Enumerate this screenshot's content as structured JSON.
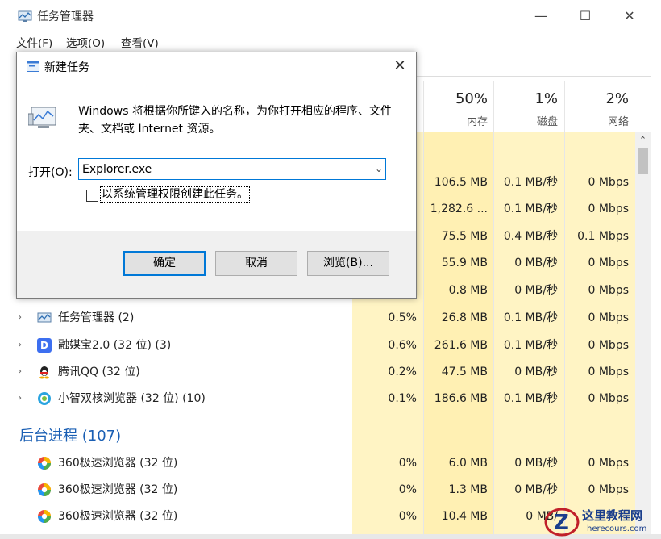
{
  "window": {
    "title": "任务管理器",
    "minimize_icon": "minimize-icon",
    "maximize_icon": "maximize-icon",
    "close_icon": "close-icon"
  },
  "menu": [
    "文件(F)",
    "选项(O)",
    "查看(V)"
  ],
  "columns": {
    "cpu_partial": "",
    "mem": {
      "pct": "50%",
      "label": "内存"
    },
    "disk": {
      "pct": "1%",
      "label": "磁盘"
    },
    "net": {
      "pct": "2%",
      "label": "网络"
    }
  },
  "hidden_rows": [
    {
      "mem": "106.5 MB",
      "disk": "0.1 MB/秒",
      "net": "0 Mbps"
    },
    {
      "mem": "1,282.6 ...",
      "disk": "0.1 MB/秒",
      "net": "0 Mbps"
    },
    {
      "mem": "75.5 MB",
      "disk": "0.4 MB/秒",
      "net": "0.1 Mbps"
    },
    {
      "mem": "55.9 MB",
      "disk": "0 MB/秒",
      "net": "0 Mbps"
    },
    {
      "mem": "0.8 MB",
      "disk": "0 MB/秒",
      "net": "0 Mbps"
    }
  ],
  "app_rows": [
    {
      "name": "任务管理器 (2)",
      "cpu": "0.5%",
      "mem": "26.8 MB",
      "disk": "0.1 MB/秒",
      "net": "0 Mbps",
      "icon": "task-manager-icon",
      "color": "#5a8fc7"
    },
    {
      "name": "融媒宝2.0 (32 位) (3)",
      "cpu": "0.6%",
      "mem": "261.6 MB",
      "disk": "0.1 MB/秒",
      "net": "0 Mbps",
      "icon": "media-app-icon",
      "color": "#3d6ff0"
    },
    {
      "name": "腾讯QQ (32 位)",
      "cpu": "0.2%",
      "mem": "47.5 MB",
      "disk": "0 MB/秒",
      "net": "0 Mbps",
      "icon": "qq-icon",
      "color": "#222222"
    },
    {
      "name": "小智双核浏览器 (32 位) (10)",
      "cpu": "0.1%",
      "mem": "186.6 MB",
      "disk": "0.1 MB/秒",
      "net": "0 Mbps",
      "icon": "browser-icon",
      "color": "#2aa4e0"
    }
  ],
  "bg_section": {
    "title": "后台进程 (107)"
  },
  "bg_rows": [
    {
      "name": "360极速浏览器 (32 位)",
      "cpu": "0%",
      "mem": "6.0 MB",
      "disk": "0 MB/秒",
      "net": "0 Mbps"
    },
    {
      "name": "360极速浏览器 (32 位)",
      "cpu": "0%",
      "mem": "1.3 MB",
      "disk": "0 MB/秒",
      "net": "0 Mbps"
    },
    {
      "name": "360极速浏览器 (32 位)",
      "cpu": "0%",
      "mem": "10.4 MB",
      "disk": "0 MB/",
      "net": ""
    }
  ],
  "dialog": {
    "title": "新建任务",
    "description": "Windows 将根据你所键入的名称，为你打开相应的程序、文件夹、文档或 Internet 资源。",
    "open_label": "打开(O):",
    "input_value": "Explorer.exe",
    "checkbox_label": "以系统管理权限创建此任务。",
    "ok": "确定",
    "cancel": "取消",
    "browse": "浏览(B)..."
  },
  "watermark": {
    "name": "这里教程网",
    "url": "herecours.com"
  }
}
